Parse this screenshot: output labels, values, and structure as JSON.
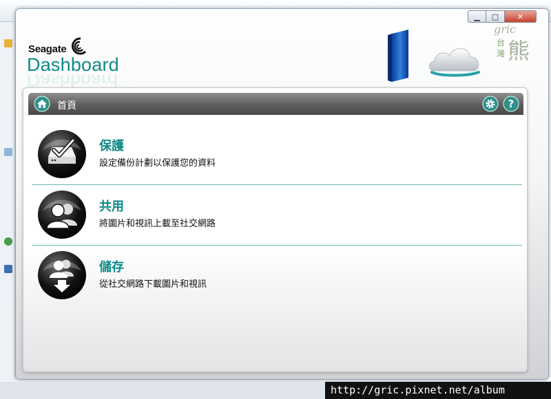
{
  "app": {
    "brand_small": "Seagate",
    "brand_big": "Dashboard",
    "window_controls": {
      "minimize": "▁",
      "maximize": "□",
      "close": "✕"
    }
  },
  "panel": {
    "title": "首頁"
  },
  "items": [
    {
      "title": "保護",
      "description": "設定備份計劃以保護您的資料",
      "icon": "backup-icon"
    },
    {
      "title": "共用",
      "description": "將圖片和視訊上載至社交網路",
      "icon": "share-icon"
    },
    {
      "title": "儲存",
      "description": "從社交網路下載圖片和視訊",
      "icon": "save-icon"
    }
  ],
  "watermark": {
    "url": "http://gric.pixnet.net/album",
    "script": "gric",
    "chars": [
      "台",
      "灣",
      "熊"
    ]
  },
  "colors": {
    "accent": "#0e8a88",
    "titlebar": "#5d5d5d",
    "close_button": "#c7402c"
  }
}
